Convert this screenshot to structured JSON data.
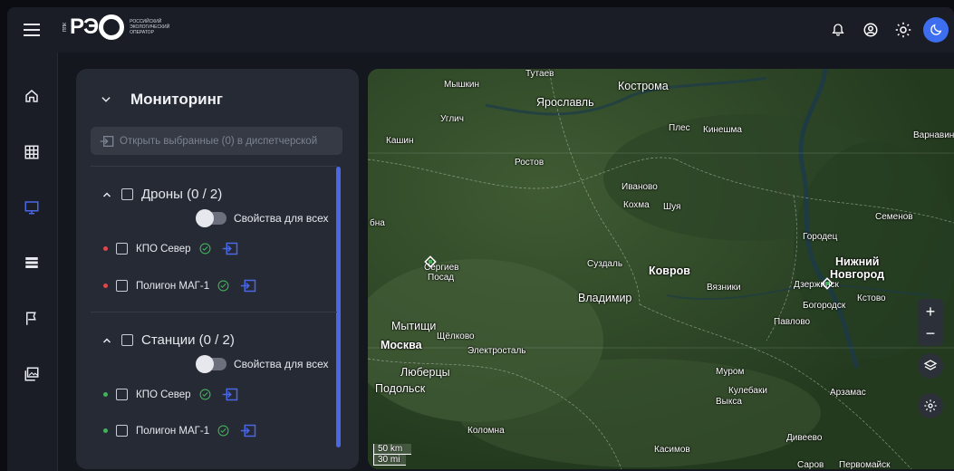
{
  "header": {
    "logo_pre": "ППК",
    "logo_word": "РЭ",
    "logo_sub": [
      "РОССИЙСКИЙ",
      "ЭКОЛОГИЧЕСКИЙ",
      "ОПЕРАТОР"
    ],
    "icons": [
      "menu-icon",
      "bell-icon",
      "account-icon",
      "sun-icon",
      "moon-icon"
    ]
  },
  "sidenav": [
    "home-icon",
    "grid-icon",
    "monitor-icon",
    "list-icon",
    "flag-icon",
    "gallery-icon"
  ],
  "panel": {
    "title": "Мониторинг",
    "open_button": "Открыть выбранные (0) в диспетчерской",
    "groups": [
      {
        "title": "Дроны (0 / 2)",
        "toggle_label": "Свойства для всех",
        "items": [
          {
            "label": "КПО Север",
            "status_color": "#e0474c"
          },
          {
            "label": "Полигон МАГ-1",
            "status_color": "#e0474c"
          }
        ]
      },
      {
        "title": "Станции (0 / 2)",
        "toggle_label": "Свойства для всех",
        "items": [
          {
            "label": "КПО Север",
            "status_color": "#43b05c"
          },
          {
            "label": "Полигон МАГ-1",
            "status_color": "#43b05c"
          }
        ]
      }
    ]
  },
  "map": {
    "labels": {
      "tutaev": "Тутаев",
      "myshkin": "Мышкин",
      "kostroma": "Кострома",
      "yaroslavl": "Ярославль",
      "uglich": "Углич",
      "kashin": "Кашин",
      "ples": "Плес",
      "kineshma": "Кинешма",
      "varnavino": "Варнавин",
      "rostov": "Ростов",
      "ivanovo": "Иваново",
      "kokhma": "Кохма",
      "shuya": "Шуя",
      "semenov": "Семенов",
      "dubna": "бна",
      "gorodets": "Городец",
      "sergiev": "Сергиев",
      "posad": "Посад",
      "suzdal": "Суздаль",
      "kovrov": "Ковров",
      "nizhny1": "Нижний",
      "nizhny2": "Новгород",
      "vyazniki": "Вязники",
      "dzerzhinsk": "Дзержинск",
      "kstovo": "Кстово",
      "vladimir": "Владимир",
      "bogorodsk": "Богородск",
      "mytishchi": "Мытищи",
      "shchelkovo": "Щёлково",
      "pavlovo": "Павлово",
      "moskva": "Москва",
      "elektrostal": "Электросталь",
      "lyubertsy": "Люберцы",
      "murom": "Муром",
      "podolsk": "Подольск",
      "kulebaki": "Кулебаки",
      "arzamas": "Арзамас",
      "vyksa": "Выкса",
      "kolomna": "Коломна",
      "diveevo": "Дивеево",
      "kasimov": "Касимов",
      "sarov": "Саров",
      "pervomaysk": "Первомайск"
    },
    "scale": [
      "50 km",
      "30 mi"
    ],
    "controls": {
      "zoom_in": "+",
      "zoom_out": "−"
    }
  },
  "colors": {
    "accent": "#4a67e6",
    "panel": "#262a34",
    "topbar": "#1a1d25"
  }
}
